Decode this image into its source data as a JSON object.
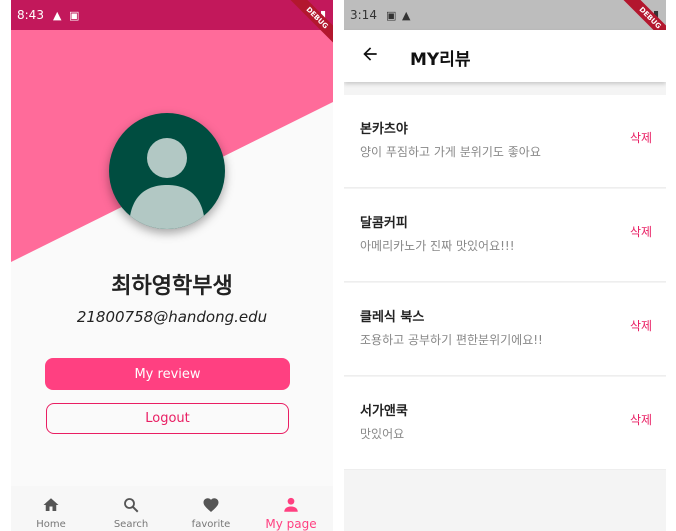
{
  "colors": {
    "pink": "#ff6b9a",
    "accent": "#ff4081",
    "avatar": "#004d40",
    "status_left": "#c2185b",
    "status_right": "#bdbdbd"
  },
  "left": {
    "status": {
      "time": "8:43",
      "icons": [
        "alert-icon",
        "image-icon"
      ],
      "right_icons": [
        "wifi-icon",
        "battery-icon"
      ]
    },
    "debug": "DEBUG",
    "profile": {
      "name": "최하영학부생",
      "email": "21800758@handong.edu"
    },
    "buttons": {
      "review": "My review",
      "logout": "Logout"
    },
    "nav": [
      {
        "label": "Home",
        "icon": "home-icon"
      },
      {
        "label": "Search",
        "icon": "search-icon"
      },
      {
        "label": "favorite",
        "icon": "heart-icon"
      },
      {
        "label": "My page",
        "icon": "person-icon",
        "active": true
      }
    ]
  },
  "right": {
    "status": {
      "time": "3:14",
      "icons": [
        "image-icon",
        "alert-icon"
      ],
      "right_icons": [
        "wifi-icon",
        "battery-icon"
      ]
    },
    "debug": "DEBUG",
    "title": "MY리뷰",
    "reviews": [
      {
        "place": "본카츠야",
        "comment": "양이 푸짐하고 가게 분위기도 좋아요",
        "delete": "삭제"
      },
      {
        "place": "달콤커피",
        "comment": "아메리카노가 진짜 맛있어요!!!",
        "delete": "삭제"
      },
      {
        "place": "클레식 북스",
        "comment": "조용하고 공부하기 편한분위기에요!!",
        "delete": "삭제"
      },
      {
        "place": "서가앤쿡",
        "comment": "맛있어요",
        "delete": "삭제"
      }
    ]
  }
}
